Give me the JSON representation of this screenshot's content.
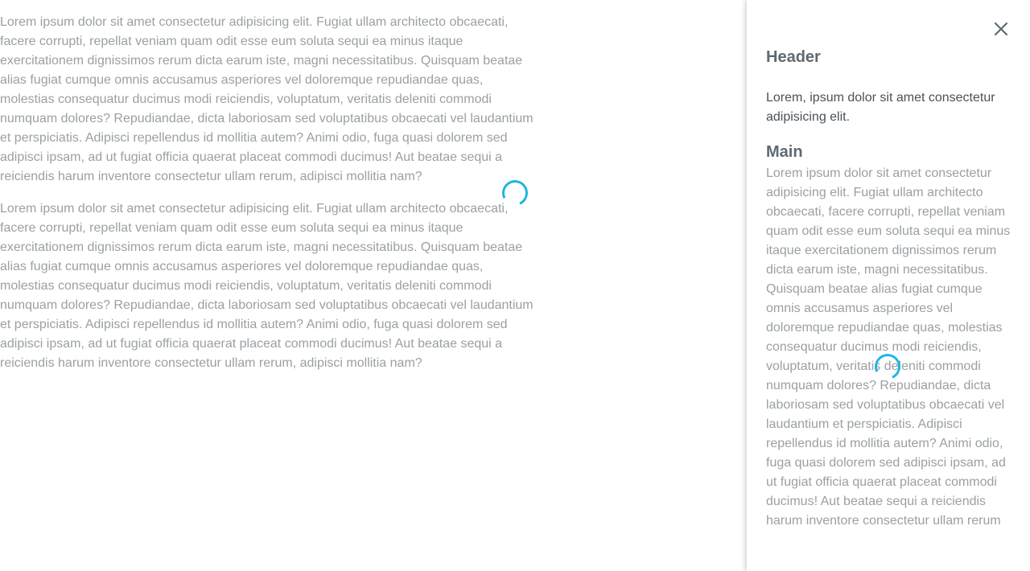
{
  "main": {
    "paragraphs": [
      "Lorem ipsum dolor sit amet consectetur adipisicing elit. Fugiat ullam architecto obcaecati, facere corrupti, repellat veniam quam odit esse eum soluta sequi ea minus itaque exercitationem dignissimos rerum dicta earum iste, magni necessitatibus. Quisquam beatae alias fugiat cumque omnis accusamus asperiores vel doloremque repudiandae quas, molestias consequatur ducimus modi reiciendis, voluptatum, veritatis deleniti commodi numquam dolores? Repudiandae, dicta laboriosam sed voluptatibus obcaecati vel laudantium et perspiciatis. Adipisci repellendus id mollitia autem? Animi odio, fuga quasi dolorem sed adipisci ipsam, ad ut fugiat officia quaerat placeat commodi ducimus! Aut beatae sequi a reiciendis harum inventore consectetur ullam rerum, adipisci mollitia nam?",
      "Lorem ipsum dolor sit amet consectetur adipisicing elit. Fugiat ullam architecto obcaecati, facere corrupti, repellat veniam quam odit esse eum soluta sequi ea minus itaque exercitationem dignissimos rerum dicta earum iste, magni necessitatibus. Quisquam beatae alias fugiat cumque omnis accusamus asperiores vel doloremque repudiandae quas, molestias consequatur ducimus modi reiciendis, voluptatum, veritatis deleniti commodi numquam dolores? Repudiandae, dicta laboriosam sed voluptatibus obcaecati vel laudantium et perspiciatis. Adipisci repellendus id mollitia autem? Animi odio, fuga quasi dolorem sed adipisci ipsam, ad ut fugiat officia quaerat placeat commodi ducimus! Aut beatae sequi a reiciendis harum inventore consectetur ullam rerum, adipisci mollitia nam?"
    ]
  },
  "panel": {
    "close_icon": "close-icon",
    "header_title": "Header",
    "header_text": "Lorem, ipsum dolor sit amet consectetur adipisicing elit.",
    "main_title": "Main",
    "main_text": "Lorem ipsum dolor sit amet consectetur adipisicing elit. Fugiat ullam architecto obcaecati, facere corrupti, repellat veniam quam odit esse eum soluta sequi ea minus itaque exercitationem dignissimos rerum dicta earum iste, magni necessitatibus. Quisquam beatae alias fugiat cumque omnis accusamus asperiores vel doloremque repudiandae quas, molestias consequatur ducimus modi reiciendis, voluptatum, veritatis deleniti commodi numquam dolores? Repudiandae, dicta laboriosam sed voluptatibus obcaecati vel laudantium et perspiciatis. Adipisci repellendus id mollitia autem? Animi odio, fuga quasi dolorem sed adipisci ipsam, ad ut fugiat officia quaerat placeat commodi ducimus! Aut beatae sequi a reiciendis harum inventore consectetur ullam rerum"
  },
  "colors": {
    "spinner": "#1eb6e0",
    "body_text": "#9aa0a4",
    "heading": "#5f6a72"
  }
}
